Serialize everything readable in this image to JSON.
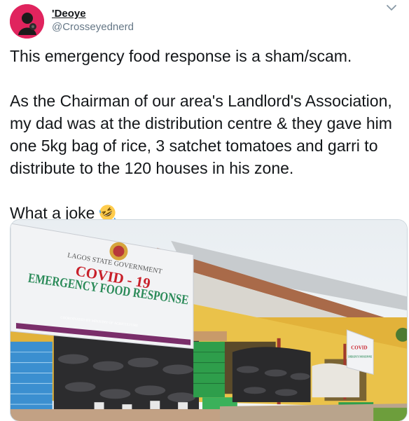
{
  "user": {
    "display_name": "'Deoye",
    "handle": "@Crosseyednerd",
    "avatar_icon": "profile-avatar"
  },
  "menu": {
    "icon": "chevron-down-icon"
  },
  "tweet": {
    "paragraphs": [
      "This emergency food response is a sham/scam.",
      "As the Chairman of our area's Landlord's Association, my dad was at the distribution centre & they gave him one 5kg bag of rice, 3 satchet tomatoes and garri to distribute to the 120 houses in his zone.",
      "What a joke"
    ],
    "emoji": "rolling-on-floor-laughing"
  },
  "media": {
    "banner": {
      "line1": "LAGOS STATE GOVERNMENT",
      "line2": "COVID - 19",
      "line3": "EMERGENCY FOOD RESPONSE",
      "line4": "COORDINATED BY MINISTRY OF AGRICULTURE"
    },
    "small_banner": {
      "line1": "COVID",
      "line2": "EMERGENCY FOOD RESPONSE"
    }
  },
  "colors": {
    "text": "#14171a",
    "secondary": "#657786",
    "banner_red": "#c8202a",
    "banner_blue": "#2b3a7a"
  }
}
